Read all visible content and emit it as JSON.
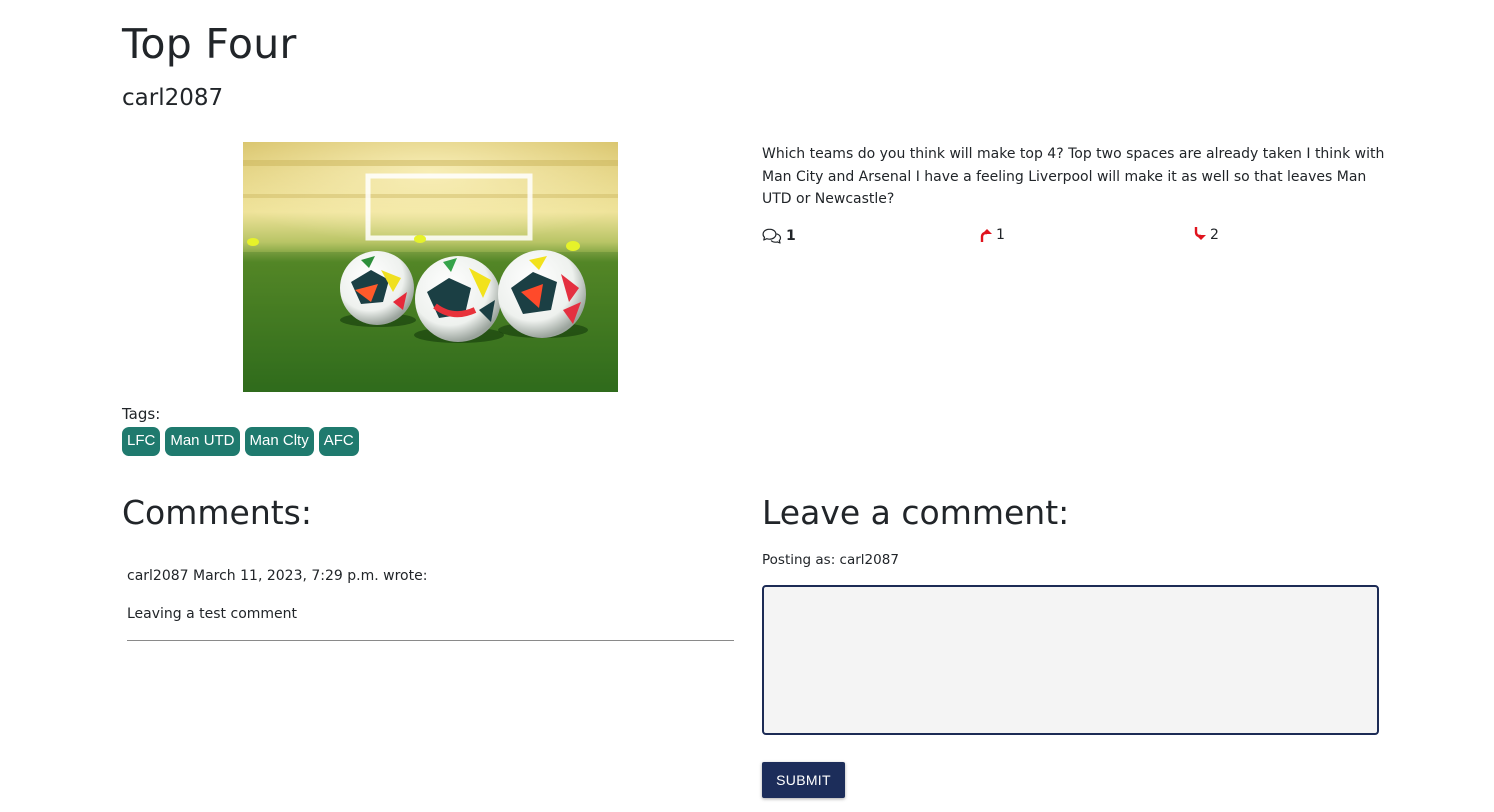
{
  "post": {
    "title": "Top Four",
    "author": "carl2087",
    "image_alt": "Three footballs on a grass pitch in front of a goal",
    "content": "Which teams do you think will make top 4? Top two spaces are already taken I think with Man City and Arsenal I have a feeling Liverpool will make it as well so that leaves Man UTD or Newcastle?",
    "tags_label": "Tags:",
    "tags": [
      "LFC",
      "Man UTD",
      "Man Clty",
      "AFC"
    ],
    "stats": {
      "comments_icon": "comments-icon",
      "comment_count": "1",
      "upvote_icon": "arrow-up-icon",
      "upvote_count": "1",
      "downvote_icon": "arrow-down-icon",
      "downvote_count": "2"
    }
  },
  "comments": {
    "heading": "Comments:",
    "items": [
      {
        "meta": "carl2087 March 11, 2023, 7:29 p.m. wrote:",
        "body": "Leaving a test comment"
      }
    ]
  },
  "comment_form": {
    "heading": "Leave a comment:",
    "posting_as": "Posting as: carl2087",
    "textarea_value": "",
    "submit_label": "SUBMIT"
  },
  "colors": {
    "tag_bg": "#1f7a6e",
    "submit_bg": "#1c2d5a",
    "vote_arrow": "#e0141e",
    "textarea_border": "#1c2b55"
  }
}
